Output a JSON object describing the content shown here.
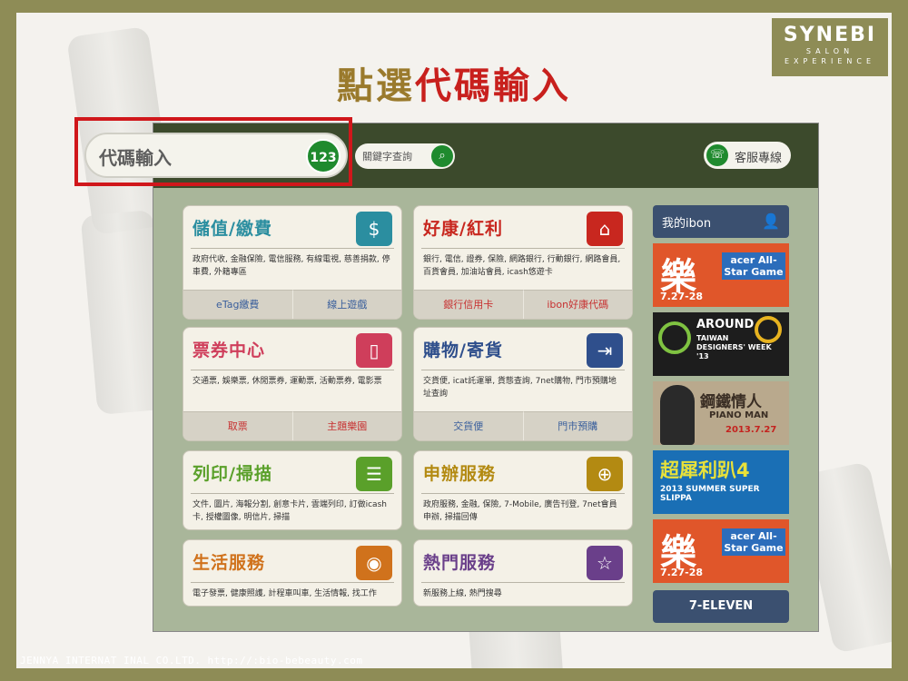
{
  "slide": {
    "title_part1": "點選",
    "title_part2": "代碼輸入",
    "footer": "JENNYA INTERNAT INAL CO.LTD.  http://:bio-bebeauty.com",
    "logo": {
      "main": "SYNEBI",
      "line1": "SALON",
      "line2": "EXPERIENCE"
    }
  },
  "topbar": {
    "code_input_label": "代碼輸入",
    "code_badge": "123",
    "search_label": "關鍵字查詢",
    "service_label": "客服專線"
  },
  "cards": [
    {
      "title": "儲值/繳費",
      "icon": "dollar-icon",
      "color": "#2b8ea0",
      "desc": "政府代收, 金融保險, 電信服務, 有線電視, 慈善捐款, 停車費, 外籍專區",
      "buttons": [
        "eTag繳費",
        "線上遊戲"
      ]
    },
    {
      "title": "好康/紅利",
      "icon": "home-icon",
      "color": "#c8271f",
      "desc": "銀行, 電信, 證券, 保險, 網路銀行, 行動銀行, 網路會員, 百貨會員, 加油站會員, icash悠遊卡",
      "buttons": [
        "銀行信用卡",
        "ibon好康代碼"
      ]
    },
    {
      "title": "票券中心",
      "icon": "ticket-icon",
      "color": "#cf3e5b",
      "desc": "交通票, 娛樂票, 休閒票券, 運動票, 活動票券, 電影票",
      "buttons": [
        "取票",
        "主題樂園"
      ]
    },
    {
      "title": "購物/寄貨",
      "icon": "export-icon",
      "color": "#2f4f8c",
      "desc": "交貨便, icat託運單, 貨態查詢, 7net購物, 門市預購地址查詢",
      "buttons": [
        "交貨便",
        "門市預購"
      ]
    },
    {
      "title": "列印/掃描",
      "icon": "document-icon",
      "color": "#5aa02a",
      "desc": "文件, 圖片, 海報分割, 創意卡片, 雲端列印, 訂做icash卡, 授權圖像, 明信片, 掃描",
      "buttons": []
    },
    {
      "title": "申辦服務",
      "icon": "plus-icon",
      "color": "#b38a12",
      "desc": "政府服務, 金融, 保險, 7-Mobile, 廣告刊登, 7net會員申辦, 掃描回傳",
      "buttons": []
    },
    {
      "title": "生活服務",
      "icon": "location-icon",
      "color": "#d0721c",
      "desc": "電子發票, 健康照護, 計程車叫車, 生活情報, 找工作",
      "buttons": []
    },
    {
      "title": "熱門服務",
      "icon": "star-icon",
      "color": "#6a3f8a",
      "desc": "新服務上線, 熱門搜尋",
      "buttons": []
    }
  ],
  "sidebar": {
    "my_ibon": "我的ibon",
    "ads": [
      {
        "name": "ad-acer-allstar",
        "big": "樂",
        "text": "acer All-Star Game",
        "date": "7.27-28",
        "bg": "#e0562a"
      },
      {
        "name": "ad-around-taiwan-designers",
        "big": "AROUND",
        "text": "TAIWAN DESIGNERS' WEEK '13",
        "date": "",
        "bg": "#1d1d1d"
      },
      {
        "name": "ad-piano-man",
        "big": "鋼鐵情人",
        "text": "PIANO MAN",
        "date": "2013.7.27",
        "bg": "#b9a98d"
      },
      {
        "name": "ad-summer-super-slippa",
        "big": "超犀利趴4",
        "text": "2013 SUMMER SUPER SLIPPA",
        "date": "",
        "bg": "#1a6fb5"
      },
      {
        "name": "ad-acer-allstar-2",
        "big": "樂",
        "text": "acer All-Star Game",
        "date": "7.27-28",
        "bg": "#e0562a"
      }
    ],
    "seven": "7-ELEVEN"
  }
}
